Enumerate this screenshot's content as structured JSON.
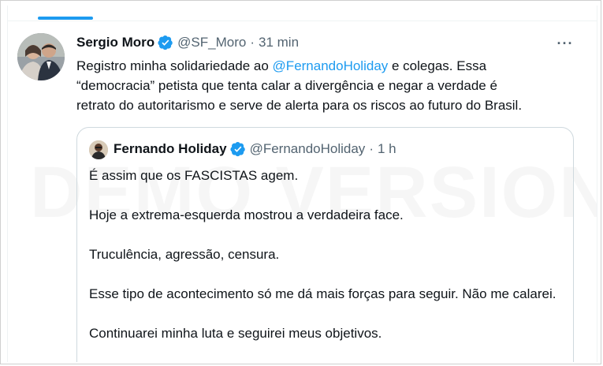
{
  "tweet": {
    "author_name": "Sergio Moro",
    "author_handle": "@SF_Moro",
    "separator": "·",
    "time": "31 min",
    "more_label": "···",
    "text_before_mention": "Registro minha solidariedade ao ",
    "mention": "@FernandoHoliday",
    "text_after_mention": " e colegas. Essa",
    "line2": "“democracia” petista que tenta calar a divergência e negar a verdade é",
    "line3": "retrato do autoritarismo e serve de alerta para os riscos ao futuro do Brasil."
  },
  "quote": {
    "author_name": "Fernando Holiday",
    "author_handle": "@FernandoHoliday",
    "separator": "·",
    "time": "1 h",
    "paragraphs": [
      "É assim que os FASCISTAS agem.",
      "Hoje a extrema-esquerda mostrou a verdadeira face.",
      "Truculência, agressão, censura.",
      "Esse tipo de acontecimento só me dá mais forças para seguir. Não me calarei.",
      "Continuarei minha luta e seguirei meus objetivos."
    ]
  },
  "watermark": "DEMO VERSION",
  "colors": {
    "accent": "#1d9bf0",
    "text": "#0f1419",
    "muted": "#536471",
    "border": "#cfd9de"
  },
  "icons": {
    "verified": "verified-badge-icon",
    "more": "more-horizontal-icon"
  }
}
